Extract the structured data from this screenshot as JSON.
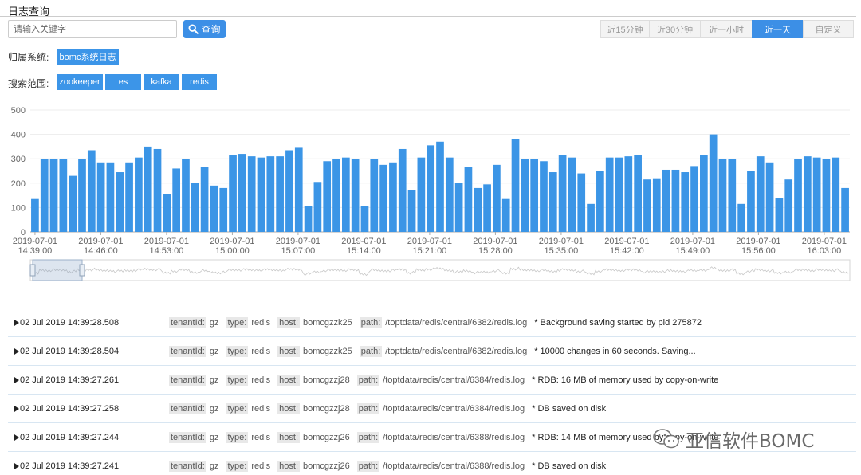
{
  "page_title": "日志查询",
  "search": {
    "placeholder": "请输入关键字",
    "button_label": "查询"
  },
  "time_ranges": [
    {
      "label": "近15分钟",
      "active": false
    },
    {
      "label": "近30分钟",
      "active": false
    },
    {
      "label": "近一小时",
      "active": false
    },
    {
      "label": "近一天",
      "active": true
    },
    {
      "label": "自定义",
      "active": false
    }
  ],
  "system": {
    "label": "归属系统:",
    "tags": [
      "bomc系统日志"
    ]
  },
  "scope": {
    "label": "搜索范围:",
    "tags": [
      "zookeeper",
      "es",
      "kafka",
      "redis"
    ]
  },
  "colors": {
    "accent": "#3c8fe6",
    "bar": "#3b95e6"
  },
  "chart_data": {
    "type": "bar",
    "ylim": [
      0,
      500
    ],
    "yticks": [
      0,
      100,
      200,
      300,
      400,
      500
    ],
    "grid": true,
    "xtick_labels": [
      [
        "2019-07-01",
        "14:39:00"
      ],
      [
        "2019-07-01",
        "14:46:00"
      ],
      [
        "2019-07-01",
        "14:53:00"
      ],
      [
        "2019-07-01",
        "15:00:00"
      ],
      [
        "2019-07-01",
        "15:07:00"
      ],
      [
        "2019-07-01",
        "15:14:00"
      ],
      [
        "2019-07-01",
        "15:21:00"
      ],
      [
        "2019-07-01",
        "15:28:00"
      ],
      [
        "2019-07-01",
        "15:35:00"
      ],
      [
        "2019-07-01",
        "15:42:00"
      ],
      [
        "2019-07-01",
        "15:49:00"
      ],
      [
        "2019-07-01",
        "15:56:00"
      ],
      [
        "2019-07-01",
        "16:03:00"
      ]
    ],
    "values": [
      135,
      300,
      300,
      300,
      230,
      300,
      335,
      285,
      285,
      245,
      285,
      305,
      350,
      340,
      155,
      260,
      300,
      200,
      265,
      190,
      180,
      315,
      320,
      310,
      305,
      310,
      310,
      335,
      345,
      105,
      205,
      290,
      300,
      305,
      300,
      105,
      300,
      275,
      285,
      340,
      170,
      305,
      355,
      370,
      305,
      200,
      265,
      180,
      195,
      275,
      135,
      380,
      300,
      300,
      290,
      245,
      315,
      305,
      240,
      115,
      250,
      305,
      305,
      310,
      315,
      215,
      220,
      255,
      255,
      245,
      270,
      315,
      400,
      300,
      300,
      115,
      250,
      310,
      285,
      140,
      215,
      300,
      310,
      305,
      300,
      305,
      180
    ]
  },
  "logs": [
    {
      "time": "02 Jul 2019 14:39:28.508",
      "tenant": "gz",
      "type": "redis",
      "host": "bomcgzzk25",
      "path": "/toptdata/redis/central/6382/redis.log",
      "message": "* Background saving started by pid 275872"
    },
    {
      "time": "02 Jul 2019 14:39:28.504",
      "tenant": "gz",
      "type": "redis",
      "host": "bomcgzzk25",
      "path": "/toptdata/redis/central/6382/redis.log",
      "message": "* 10000 changes in 60 seconds. Saving..."
    },
    {
      "time": "02 Jul 2019 14:39:27.261",
      "tenant": "gz",
      "type": "redis",
      "host": "bomcgzzj28",
      "path": "/toptdata/redis/central/6384/redis.log",
      "message": "* RDB: 16 MB of memory used by copy-on-write"
    },
    {
      "time": "02 Jul 2019 14:39:27.258",
      "tenant": "gz",
      "type": "redis",
      "host": "bomcgzzj28",
      "path": "/toptdata/redis/central/6384/redis.log",
      "message": "* DB saved on disk"
    },
    {
      "time": "02 Jul 2019 14:39:27.244",
      "tenant": "gz",
      "type": "redis",
      "host": "bomcgzzj26",
      "path": "/toptdata/redis/central/6388/redis.log",
      "message": "* RDB: 14 MB of memory used by copy-on-write"
    },
    {
      "time": "02 Jul 2019 14:39:27.241",
      "tenant": "gz",
      "type": "redis",
      "host": "bomcgzzj26",
      "path": "/toptdata/redis/central/6388/redis.log",
      "message": "* DB saved on disk"
    }
  ],
  "field_labels": {
    "tenant": "tenantId:",
    "type": "type:",
    "host": "host:",
    "path": "path:"
  },
  "watermark": {
    "text": "亚信软件BOMC",
    "icon": "wechat-icon"
  }
}
